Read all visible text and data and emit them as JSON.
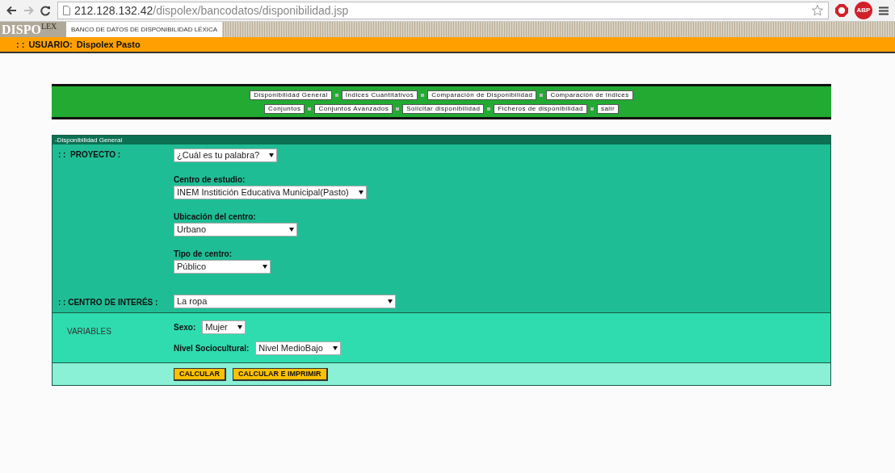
{
  "browser": {
    "url_host": "212.128.132.42",
    "url_path": "/dispolex/bancodatos/disponibilidad.jsp",
    "abp_label": "ABP"
  },
  "header": {
    "logo_main": "DISPO",
    "logo_sub": "LEX",
    "title": "BANCO DE DATOS DE DISPONIBILIDAD LÉXICA"
  },
  "user_bar": {
    "prefix": ": :",
    "label": "USUARIO:",
    "name": "Dispolex Pasto"
  },
  "nav_rows": [
    [
      "Disponibilidad General",
      "Indices Cuantitativos",
      "Comparación de Disponibilidad",
      "Comparación de Indices"
    ],
    [
      "Conjuntos",
      "Conjuntos Avanzados",
      "Solicitar disponibilidad",
      "Ficheros de disponibilidad",
      "salir"
    ]
  ],
  "section_title": "-Disponibilidad General",
  "proyecto": {
    "label": ": :  PROYECTO :",
    "value": "¿Cuál es tu palabra?",
    "fields": [
      {
        "label": "Centro de estudio:",
        "value": "INEM Institición Educativa Municipal(Pasto)"
      },
      {
        "label": "Ubicación del centro:",
        "value": "Urbano"
      },
      {
        "label": "Tipo de centro:",
        "value": "Público"
      }
    ]
  },
  "interes": {
    "label": ": : CENTRO DE INTERÉS :",
    "value": "La ropa"
  },
  "variables": {
    "label": "VARIABLES",
    "fields": [
      {
        "label": "Sexo:",
        "value": "Mujer"
      },
      {
        "label": "Nivel Sociocultural:",
        "value": "Nivel MedioBajo"
      }
    ]
  },
  "buttons": [
    "CALCULAR",
    "CALCULAR E IMPRIMIR"
  ]
}
